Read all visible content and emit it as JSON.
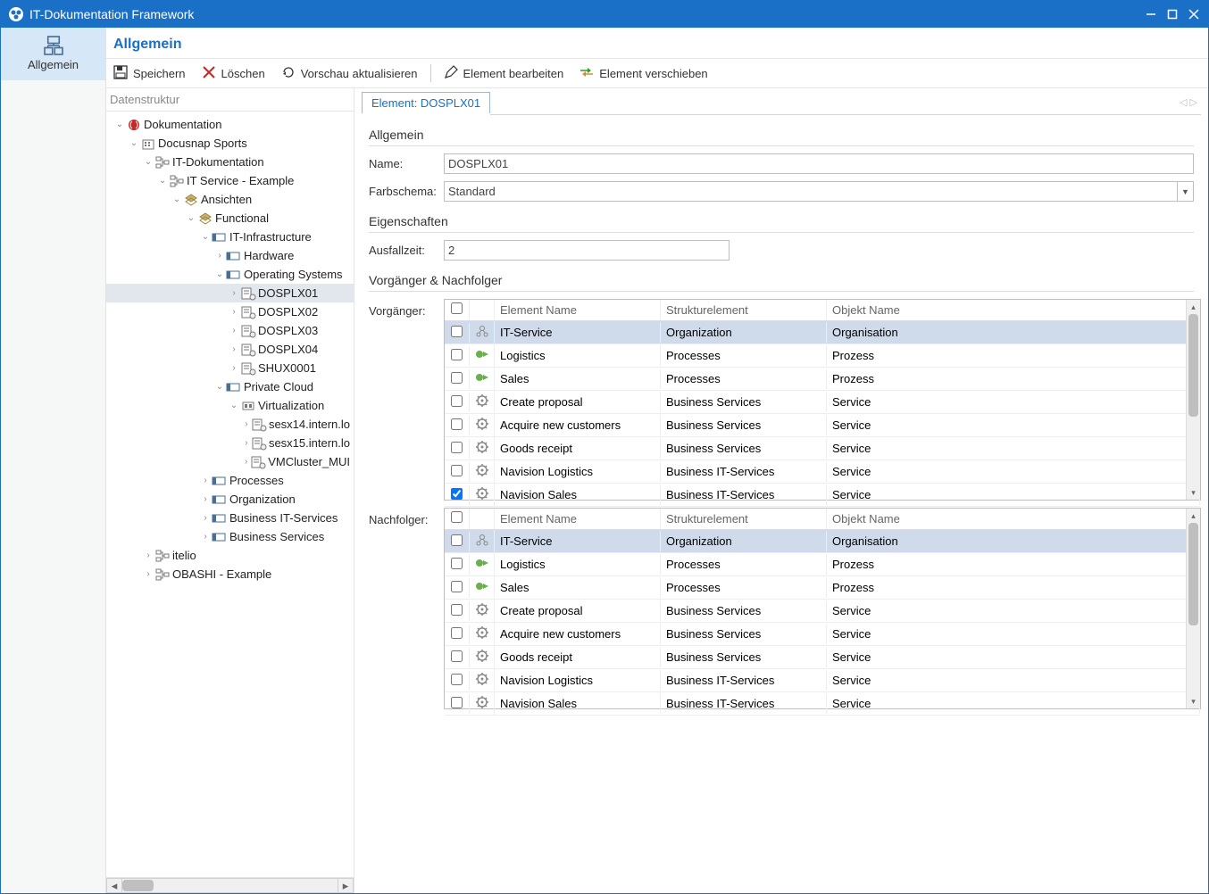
{
  "app_title": "IT-Dokumentation Framework",
  "leftnav": {
    "tab_label": "Allgemein"
  },
  "panel_title": "Allgemein",
  "toolbar": {
    "save": "Speichern",
    "delete": "Löschen",
    "refresh": "Vorschau aktualisieren",
    "edit": "Element bearbeiten",
    "move": "Element verschieben"
  },
  "tree_header": "Datenstruktur",
  "tree": [
    {
      "level": 0,
      "exp": "v",
      "icon": "doc-root",
      "label": "Dokumentation"
    },
    {
      "level": 1,
      "exp": "v",
      "icon": "company",
      "label": "Docusnap Sports"
    },
    {
      "level": 2,
      "exp": "v",
      "icon": "itdoc",
      "label": "IT-Dokumentation"
    },
    {
      "level": 3,
      "exp": "v",
      "icon": "itdoc",
      "label": "IT Service - Example"
    },
    {
      "level": 4,
      "exp": "v",
      "icon": "layers",
      "label": "Ansichten"
    },
    {
      "level": 5,
      "exp": "v",
      "icon": "layers",
      "label": "Functional"
    },
    {
      "level": 6,
      "exp": "v",
      "icon": "struct",
      "label": "IT-Infrastructure"
    },
    {
      "level": 7,
      "exp": ">",
      "icon": "struct",
      "label": "Hardware"
    },
    {
      "level": 7,
      "exp": "v",
      "icon": "struct",
      "label": "Operating Systems"
    },
    {
      "level": 8,
      "exp": ">",
      "icon": "server",
      "label": "DOSPLX01",
      "selected": true
    },
    {
      "level": 8,
      "exp": ">",
      "icon": "server",
      "label": "DOSPLX02"
    },
    {
      "level": 8,
      "exp": ">",
      "icon": "server",
      "label": "DOSPLX03"
    },
    {
      "level": 8,
      "exp": ">",
      "icon": "server",
      "label": "DOSPLX04"
    },
    {
      "level": 8,
      "exp": ">",
      "icon": "server",
      "label": "SHUX0001"
    },
    {
      "level": 7,
      "exp": "v",
      "icon": "struct",
      "label": "Private Cloud"
    },
    {
      "level": 8,
      "exp": "v",
      "icon": "virt",
      "label": "Virtualization"
    },
    {
      "level": 9,
      "exp": ">",
      "icon": "server",
      "label": "sesx14.intern.lo"
    },
    {
      "level": 9,
      "exp": ">",
      "icon": "server",
      "label": "sesx15.intern.lo"
    },
    {
      "level": 9,
      "exp": ">",
      "icon": "server",
      "label": "VMCluster_MUI"
    },
    {
      "level": 6,
      "exp": ">",
      "icon": "struct",
      "label": "Processes"
    },
    {
      "level": 6,
      "exp": ">",
      "icon": "struct",
      "label": "Organization"
    },
    {
      "level": 6,
      "exp": ">",
      "icon": "struct",
      "label": "Business IT-Services"
    },
    {
      "level": 6,
      "exp": ">",
      "icon": "struct",
      "label": "Business Services"
    },
    {
      "level": 2,
      "exp": ">",
      "icon": "itdoc",
      "label": "itelio"
    },
    {
      "level": 2,
      "exp": ">",
      "icon": "itdoc",
      "label": "OBASHI - Example"
    }
  ],
  "element_tab": "Element: DOSPLX01",
  "sections": {
    "allgemein": "Allgemein",
    "eigenschaften": "Eigenschaften",
    "vn": "Vorgänger & Nachfolger"
  },
  "form": {
    "name_label": "Name:",
    "name_value": "DOSPLX01",
    "colorscheme_label": "Farbschema:",
    "colorscheme_value": "Standard",
    "ausfallzeit_label": "Ausfallzeit:",
    "ausfallzeit_value": "2",
    "vorgaenger_label": "Vorgänger:",
    "nachfolger_label": "Nachfolger:"
  },
  "grid_headers": {
    "name": "Element Name",
    "struct": "Strukturelement",
    "obj": "Objekt Name"
  },
  "vorgaenger": [
    {
      "checked": false,
      "icon": "org",
      "name": "IT-Service",
      "struct": "Organization",
      "obj": "Organisation",
      "selected": true
    },
    {
      "checked": false,
      "icon": "proc",
      "name": "Logistics",
      "struct": "Processes",
      "obj": "Prozess"
    },
    {
      "checked": false,
      "icon": "proc",
      "name": "Sales",
      "struct": "Processes",
      "obj": "Prozess"
    },
    {
      "checked": false,
      "icon": "gear",
      "name": "Create proposal",
      "struct": "Business Services",
      "obj": "Service"
    },
    {
      "checked": false,
      "icon": "gear",
      "name": "Acquire new customers",
      "struct": "Business Services",
      "obj": "Service"
    },
    {
      "checked": false,
      "icon": "gear",
      "name": "Goods receipt",
      "struct": "Business Services",
      "obj": "Service"
    },
    {
      "checked": false,
      "icon": "gear",
      "name": "Navision Logistics",
      "struct": "Business IT-Services",
      "obj": "Service"
    },
    {
      "checked": true,
      "icon": "gear",
      "name": "Navision Sales",
      "struct": "Business IT-Services",
      "obj": "Service"
    }
  ],
  "nachfolger": [
    {
      "checked": false,
      "icon": "org",
      "name": "IT-Service",
      "struct": "Organization",
      "obj": "Organisation",
      "selected": true
    },
    {
      "checked": false,
      "icon": "proc",
      "name": "Logistics",
      "struct": "Processes",
      "obj": "Prozess"
    },
    {
      "checked": false,
      "icon": "proc",
      "name": "Sales",
      "struct": "Processes",
      "obj": "Prozess"
    },
    {
      "checked": false,
      "icon": "gear",
      "name": "Create proposal",
      "struct": "Business Services",
      "obj": "Service"
    },
    {
      "checked": false,
      "icon": "gear",
      "name": "Acquire new customers",
      "struct": "Business Services",
      "obj": "Service"
    },
    {
      "checked": false,
      "icon": "gear",
      "name": "Goods receipt",
      "struct": "Business Services",
      "obj": "Service"
    },
    {
      "checked": false,
      "icon": "gear",
      "name": "Navision Logistics",
      "struct": "Business IT-Services",
      "obj": "Service"
    },
    {
      "checked": false,
      "icon": "gear",
      "name": "Navision Sales",
      "struct": "Business IT-Services",
      "obj": "Service"
    }
  ]
}
